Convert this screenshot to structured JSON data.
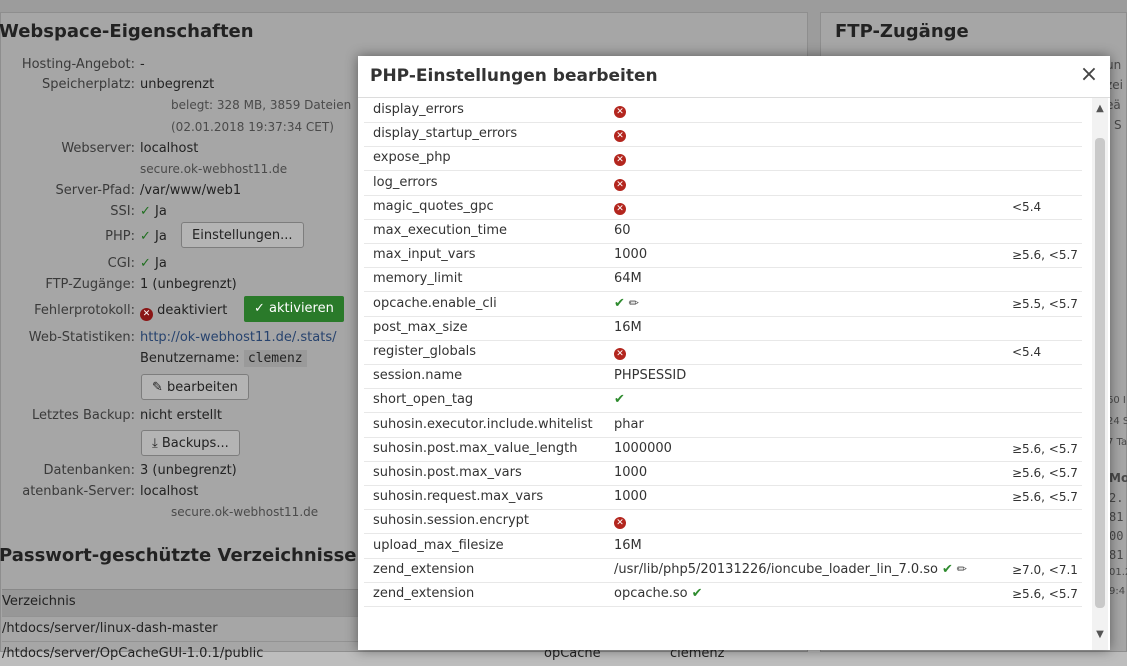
{
  "left_panel": {
    "title": "Webspace-Eigenschaften",
    "hosting_label": "Hosting-Angebot:",
    "hosting_value": "-",
    "storage_label": "Speicherplatz:",
    "storage_value": "unbegrenzt",
    "storage_used": "belegt: 328 MB, 3859 Dateien",
    "storage_date": "(02.01.2018 19:37:34 CET)",
    "webserver_label": "Webserver:",
    "webserver_value": "localhost",
    "webserver_host": "secure.ok-webhost11.de",
    "server_path_label": "Server-Pfad:",
    "server_path_value": "/var/www/web1",
    "ssi_label": "SSI:",
    "ssi_value": "Ja",
    "php_label": "PHP:",
    "php_value": "Ja",
    "php_button": "Einstellungen...",
    "cgi_label": "CGI:",
    "cgi_value": "Ja",
    "ftp_label": "FTP-Zugänge:",
    "ftp_value": "1 (unbegrenzt)",
    "error_log_label": "Fehlerprotokoll:",
    "error_log_value": "deaktiviert",
    "error_log_button": "aktivieren",
    "webstats_label": "Web-Statistiken:",
    "webstats_link": "http://ok-webhost11.de/.stats/",
    "username_label": "Benutzername:",
    "username_value": "clemenz",
    "edit_button": "bearbeiten",
    "backup_label": "Letztes Backup:",
    "backup_value": "nicht erstellt",
    "backups_button": "Backups...",
    "databases_label": "Datenbanken:",
    "databases_value": "3 (unbegrenzt)",
    "db_server_label": "atenbank-Server:",
    "db_server_value": "localhost",
    "db_server_host": "secure.ok-webhost11.de",
    "protected_title": "Passwort-geschützte Verzeichnisse",
    "dir_header": "Verzeichnis",
    "dirs": [
      {
        "path": "/htdocs/server/linux-dash-master",
        "realm": "",
        "user": ""
      },
      {
        "path": "/htdocs/server/OpCacheGUI-1.0.1/public",
        "realm": "opCache",
        "user": "clemenz"
      }
    ]
  },
  "right_panel": {
    "title": "FTP-Zugänge",
    "fragments": [
      "un",
      "zei",
      "eä",
      "S",
      "60 I",
      "24 S",
      "7 Ta",
      "Mo",
      "2.",
      "81",
      "00",
      "81",
      "01.2",
      "9:4"
    ]
  },
  "modal": {
    "title": "PHP-Einstellungen bearbeiten",
    "close_label": "×",
    "settings": [
      {
        "name": "display_errors",
        "value": "",
        "status": "off",
        "tool": false,
        "version": ""
      },
      {
        "name": "display_startup_errors",
        "value": "",
        "status": "off",
        "tool": false,
        "version": ""
      },
      {
        "name": "expose_php",
        "value": "",
        "status": "off",
        "tool": false,
        "version": ""
      },
      {
        "name": "log_errors",
        "value": "",
        "status": "off",
        "tool": false,
        "version": ""
      },
      {
        "name": "magic_quotes_gpc",
        "value": "",
        "status": "off",
        "tool": false,
        "version": "<5.4"
      },
      {
        "name": "max_execution_time",
        "value": "60",
        "status": "",
        "tool": false,
        "version": ""
      },
      {
        "name": "max_input_vars",
        "value": "1000",
        "status": "",
        "tool": false,
        "version": "≥5.6, <5.7"
      },
      {
        "name": "memory_limit",
        "value": "64M",
        "status": "",
        "tool": false,
        "version": ""
      },
      {
        "name": "opcache.enable_cli",
        "value": "",
        "status": "on",
        "tool": true,
        "version": "≥5.5, <5.7"
      },
      {
        "name": "post_max_size",
        "value": "16M",
        "status": "",
        "tool": false,
        "version": ""
      },
      {
        "name": "register_globals",
        "value": "",
        "status": "off",
        "tool": false,
        "version": "<5.4"
      },
      {
        "name": "session.name",
        "value": "PHPSESSID",
        "status": "",
        "tool": false,
        "version": ""
      },
      {
        "name": "short_open_tag",
        "value": "",
        "status": "on",
        "tool": false,
        "version": ""
      },
      {
        "name": "suhosin.executor.include.whitelist",
        "value": "phar",
        "status": "",
        "tool": false,
        "version": ""
      },
      {
        "name": "suhosin.post.max_value_length",
        "value": "1000000",
        "status": "",
        "tool": false,
        "version": "≥5.6, <5.7"
      },
      {
        "name": "suhosin.post.max_vars",
        "value": "1000",
        "status": "",
        "tool": false,
        "version": "≥5.6, <5.7"
      },
      {
        "name": "suhosin.request.max_vars",
        "value": "1000",
        "status": "",
        "tool": false,
        "version": "≥5.6, <5.7"
      },
      {
        "name": "suhosin.session.encrypt",
        "value": "",
        "status": "off",
        "tool": false,
        "version": ""
      },
      {
        "name": "upload_max_filesize",
        "value": "16M",
        "status": "",
        "tool": false,
        "version": ""
      },
      {
        "name": "zend_extension",
        "value": "/usr/lib/php5/20131226/ioncube_loader_lin_7.0.so",
        "status": "on",
        "tool": true,
        "version": "≥7.0, <7.1"
      },
      {
        "name": "zend_extension",
        "value": "opcache.so",
        "status": "on",
        "tool": false,
        "version": "≥5.6, <5.7"
      }
    ]
  },
  "colors": {
    "check_green": "#2e8b2e",
    "cross_red": "#b3261e",
    "button_green": "#2a7a2a",
    "link_blue": "#27436e"
  },
  "icons": {
    "disabled": "cross-circle-icon",
    "enabled": "checkmark-icon",
    "configure": "wrench-icon",
    "close": "close-icon",
    "edit": "pencil-icon",
    "download": "download-icon"
  }
}
